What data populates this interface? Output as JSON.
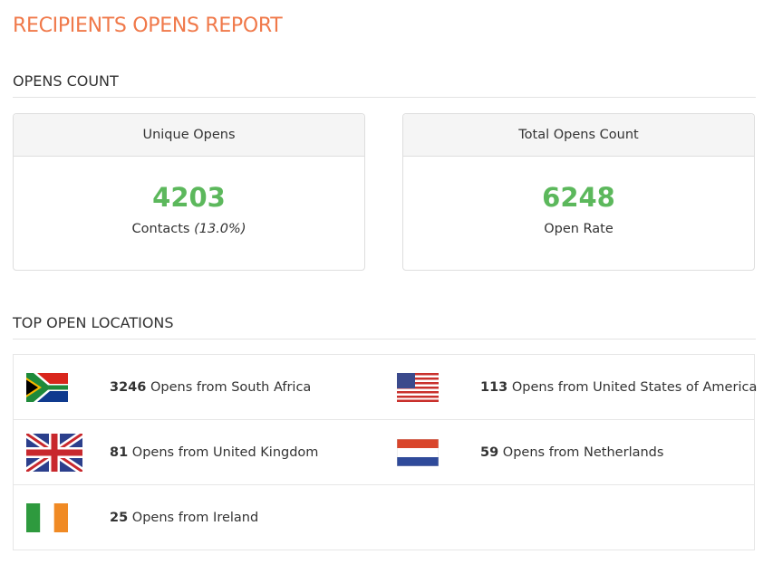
{
  "page_title": "RECIPIENTS OPENS REPORT",
  "opens_section": {
    "title": "OPENS COUNT"
  },
  "cards": [
    {
      "header": "Unique Opens",
      "value": "4203",
      "sub_label": "Contacts",
      "sub_extra": "(13.0%)"
    },
    {
      "header": "Total Opens Count",
      "value": "6248",
      "sub_label": "Open Rate"
    }
  ],
  "locations_section": {
    "title": "TOP OPEN LOCATIONS"
  },
  "locations": [
    {
      "count": "3246",
      "text": "Opens from South Africa",
      "flag": "south-africa-flag"
    },
    {
      "count": "113",
      "text": "Opens from United States of America",
      "flag": "usa-flag"
    },
    {
      "count": "81",
      "text": "Opens from United Kingdom",
      "flag": "uk-flag"
    },
    {
      "count": "59",
      "text": "Opens from Netherlands",
      "flag": "netherlands-flag"
    },
    {
      "count": "25",
      "text": "Opens from Ireland",
      "flag": "ireland-flag"
    }
  ],
  "colors": {
    "title": "#f0794a",
    "value": "#5cb85c",
    "border": "#dedede"
  }
}
